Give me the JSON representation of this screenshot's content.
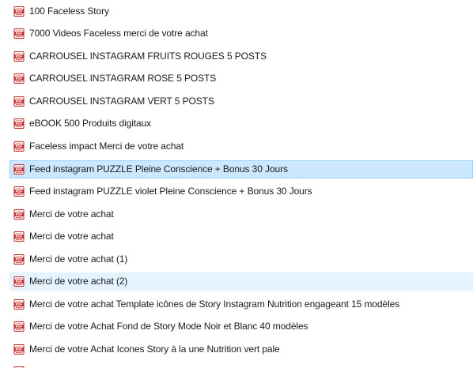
{
  "accent": "#cc2222",
  "selection_color": "#cce8ff",
  "hover_color": "#e5f3ff",
  "files": [
    {
      "name": "100 Faceless Story",
      "icon": "pdf-file-icon",
      "state": "normal"
    },
    {
      "name": "7000 Videos Faceless  merci de votre achat",
      "icon": "pdf-file-icon",
      "state": "normal"
    },
    {
      "name": "CARROUSEL INSTAGRAM FRUITS ROUGES  5 POSTS",
      "icon": "pdf-file-icon",
      "state": "normal"
    },
    {
      "name": "CARROUSEL INSTAGRAM ROSE 5 POSTS",
      "icon": "pdf-file-icon",
      "state": "normal"
    },
    {
      "name": "CARROUSEL INSTAGRAM VERT 5 POSTS",
      "icon": "pdf-file-icon",
      "state": "normal"
    },
    {
      "name": "eBOOK 500 Produits digitaux",
      "icon": "pdf-file-icon",
      "state": "normal"
    },
    {
      "name": "Faceless impact Merci de votre achat",
      "icon": "pdf-file-icon",
      "state": "normal"
    },
    {
      "name": "Feed instagram PUZZLE Pleine Conscience + Bonus  30 Jours",
      "icon": "pdf-file-icon",
      "state": "selected"
    },
    {
      "name": "Feed instagram PUZZLE violet  Pleine Conscience + Bonus  30 Jours",
      "icon": "pdf-file-icon",
      "state": "normal"
    },
    {
      "name": "Merci de votre achat",
      "icon": "pdf-file-icon",
      "state": "normal"
    },
    {
      "name": "Merci de votre achat",
      "icon": "pdf-file-icon",
      "state": "normal"
    },
    {
      "name": "Merci de votre achat  (1)",
      "icon": "pdf-file-icon",
      "state": "normal"
    },
    {
      "name": "Merci de votre achat  (2)",
      "icon": "pdf-file-icon",
      "state": "hover"
    },
    {
      "name": "Merci de votre achat  Template icônes de Story Instagram Nutrition engageant 15 modèles",
      "icon": "pdf-file-icon",
      "state": "normal"
    },
    {
      "name": "Merci de votre Achat Fond de Story Mode Noir et Blanc 40 modèles",
      "icon": "pdf-file-icon",
      "state": "normal"
    },
    {
      "name": "Merci de votre Achat Icones Story à la une Nutrition vert pale",
      "icon": "pdf-file-icon",
      "state": "normal"
    }
  ]
}
